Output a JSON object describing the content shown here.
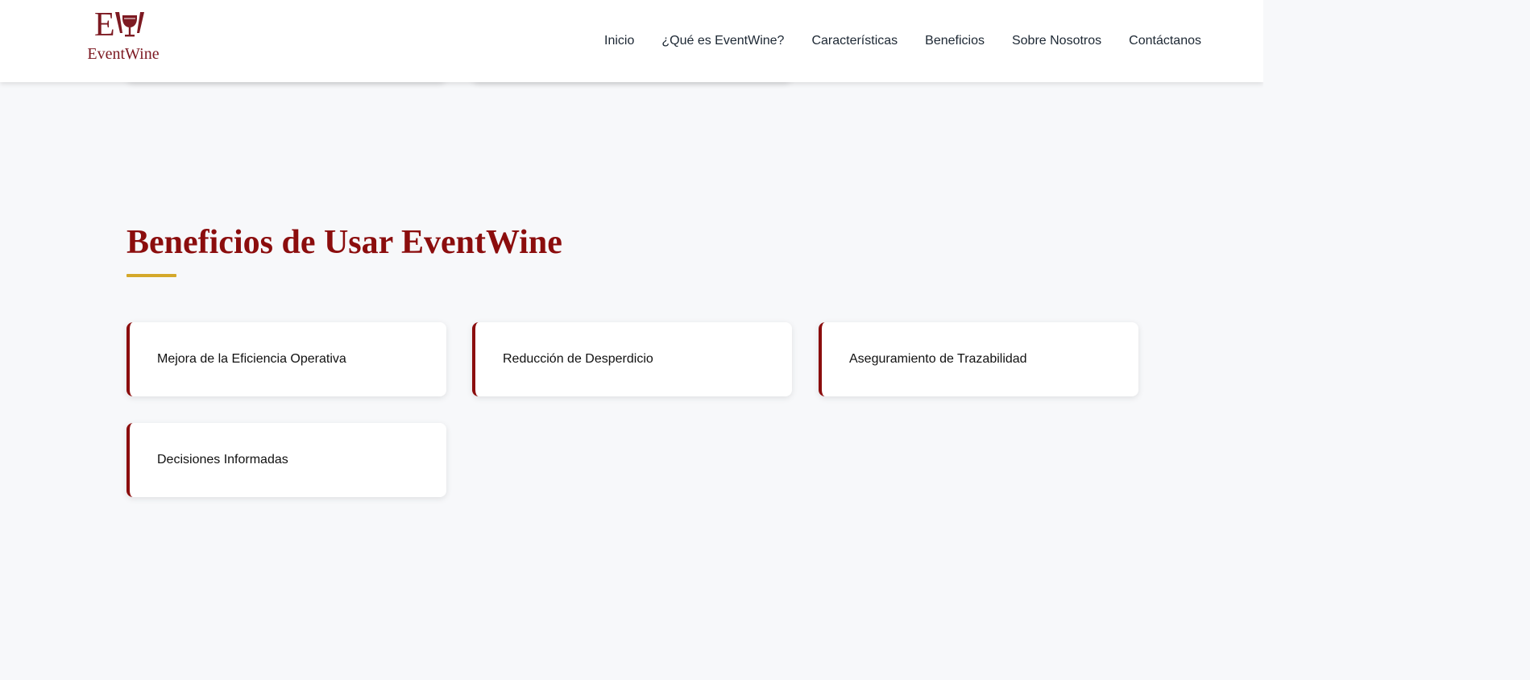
{
  "brand": {
    "logo_text": "EventWine",
    "logo_letter": "E",
    "color": "#7d1a22"
  },
  "nav": {
    "items": [
      {
        "label": "Inicio"
      },
      {
        "label": "¿Qué es EventWine?"
      },
      {
        "label": "Características"
      },
      {
        "label": "Beneficios"
      },
      {
        "label": "Sobre Nosotros"
      },
      {
        "label": "Contáctanos"
      }
    ]
  },
  "section": {
    "title": "Beneficios de Usar EventWine",
    "accent": "#8b0d0d",
    "underline_color": "#d4a82a",
    "cards": [
      {
        "label": "Mejora de la Eficiencia Operativa"
      },
      {
        "label": "Reducción de Desperdicio"
      },
      {
        "label": "Aseguramiento de Trazabilidad"
      },
      {
        "label": "Decisiones Informadas"
      }
    ]
  }
}
